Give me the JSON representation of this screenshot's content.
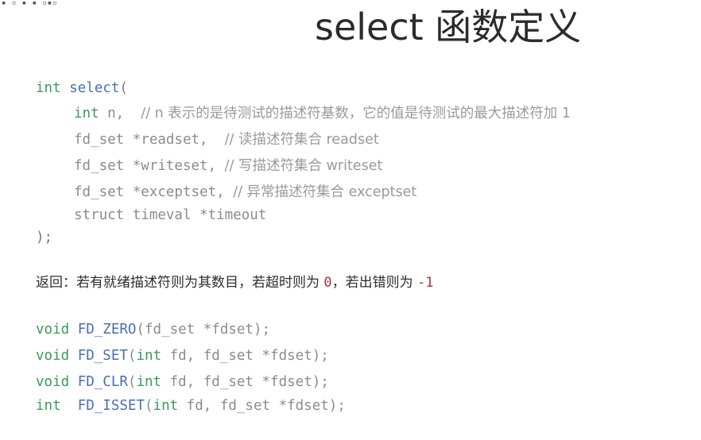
{
  "corner_mark": "▪ ▫ ▪ ▪ ▫▪▫",
  "title": "select 函数定义",
  "signature": {
    "open": {
      "type": "int",
      "name": "select",
      "paren": "("
    },
    "params": [
      {
        "type": "int",
        "decl": " n,  ",
        "comment": "// n 表示的是待测试的描述符基数，它的值是待测试的最大描述符加 1"
      },
      {
        "type": "",
        "decl": "fd_set *readset,  ",
        "comment": "// 读描述符集合 readset"
      },
      {
        "type": "",
        "decl": "fd_set *writeset, ",
        "comment": "// 写描述符集合 writeset"
      },
      {
        "type": "",
        "decl": "fd_set *exceptset, ",
        "comment": "// 异常描述符集合 exceptset"
      },
      {
        "type": "",
        "decl": "struct timeval *timeout",
        "comment": ""
      }
    ],
    "close": ");"
  },
  "return_info": {
    "prefix": "返回：若有就绪描述符则为其数目，若超时则为 ",
    "zero": "0",
    "middle": "，若出错则为 ",
    "neg": "-1"
  },
  "macros": [
    {
      "ret": "void",
      "name": "FD_ZERO",
      "args": "(fd_set *fdset);",
      "arg_type": ""
    },
    {
      "ret": "void",
      "name": "FD_SET",
      "arg_type": "int",
      "args": " fd, fd_set *fdset);"
    },
    {
      "ret": "void",
      "name": "FD_CLR",
      "arg_type": "int",
      "args": " fd, fd_set *fdset);"
    },
    {
      "ret": "int",
      "name": "FD_ISSET",
      "arg_type": "int",
      "args": " fd, fd_set *fdset);"
    }
  ],
  "colors": {
    "keyword": "#3a9a5a",
    "function": "#4a6fb5",
    "number": "#b0303a"
  }
}
